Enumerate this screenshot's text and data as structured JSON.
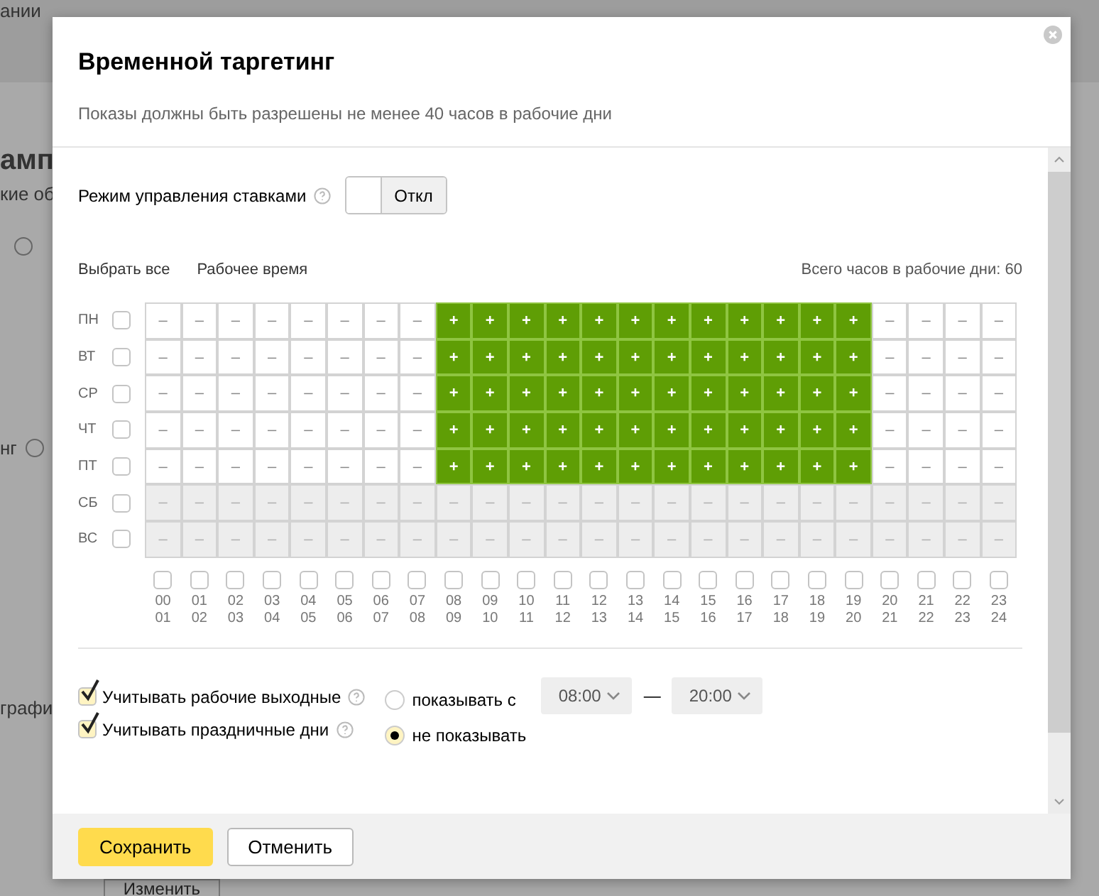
{
  "background": {
    "top_text": "ании",
    "heading": "амп",
    "subtext": "кие об",
    "row_label": "нг",
    "row_label_2": "графи",
    "button": "Изменить"
  },
  "dialog": {
    "title": "Временной таргетинг",
    "subtitle": "Показы должны быть разрешены не менее 40 часов в рабочие дни"
  },
  "bid_mode": {
    "label": "Режим управления ставками",
    "value": "Откл",
    "on": false
  },
  "links": [
    "Выбрать все",
    "Рабочее время"
  ],
  "total": "Всего часов в рабочие дни: 60",
  "days": [
    {
      "label": "ПН",
      "checked": false,
      "weekend": false,
      "cells": [
        "–",
        "–",
        "–",
        "–",
        "–",
        "–",
        "–",
        "–",
        "+",
        "+",
        "+",
        "+",
        "+",
        "+",
        "+",
        "+",
        "+",
        "+",
        "+",
        "+",
        "–",
        "–",
        "–",
        "–"
      ],
      "on": [
        false,
        false,
        false,
        false,
        false,
        false,
        false,
        false,
        true,
        true,
        true,
        true,
        true,
        true,
        true,
        true,
        true,
        true,
        true,
        true,
        false,
        false,
        false,
        false
      ]
    },
    {
      "label": "ВТ",
      "checked": false,
      "weekend": false,
      "cells": [
        "–",
        "–",
        "–",
        "–",
        "–",
        "–",
        "–",
        "–",
        "+",
        "+",
        "+",
        "+",
        "+",
        "+",
        "+",
        "+",
        "+",
        "+",
        "+",
        "+",
        "–",
        "–",
        "–",
        "–"
      ],
      "on": [
        false,
        false,
        false,
        false,
        false,
        false,
        false,
        false,
        true,
        true,
        true,
        true,
        true,
        true,
        true,
        true,
        true,
        true,
        true,
        true,
        false,
        false,
        false,
        false
      ]
    },
    {
      "label": "СР",
      "checked": false,
      "weekend": false,
      "cells": [
        "–",
        "–",
        "–",
        "–",
        "–",
        "–",
        "–",
        "–",
        "+",
        "+",
        "+",
        "+",
        "+",
        "+",
        "+",
        "+",
        "+",
        "+",
        "+",
        "+",
        "–",
        "–",
        "–",
        "–"
      ],
      "on": [
        false,
        false,
        false,
        false,
        false,
        false,
        false,
        false,
        true,
        true,
        true,
        true,
        true,
        true,
        true,
        true,
        true,
        true,
        true,
        true,
        false,
        false,
        false,
        false
      ]
    },
    {
      "label": "ЧТ",
      "checked": false,
      "weekend": false,
      "cells": [
        "–",
        "–",
        "–",
        "–",
        "–",
        "–",
        "–",
        "–",
        "+",
        "+",
        "+",
        "+",
        "+",
        "+",
        "+",
        "+",
        "+",
        "+",
        "+",
        "+",
        "–",
        "–",
        "–",
        "–"
      ],
      "on": [
        false,
        false,
        false,
        false,
        false,
        false,
        false,
        false,
        true,
        true,
        true,
        true,
        true,
        true,
        true,
        true,
        true,
        true,
        true,
        true,
        false,
        false,
        false,
        false
      ]
    },
    {
      "label": "ПТ",
      "checked": false,
      "weekend": false,
      "cells": [
        "–",
        "–",
        "–",
        "–",
        "–",
        "–",
        "–",
        "–",
        "+",
        "+",
        "+",
        "+",
        "+",
        "+",
        "+",
        "+",
        "+",
        "+",
        "+",
        "+",
        "–",
        "–",
        "–",
        "–"
      ],
      "on": [
        false,
        false,
        false,
        false,
        false,
        false,
        false,
        false,
        true,
        true,
        true,
        true,
        true,
        true,
        true,
        true,
        true,
        true,
        true,
        true,
        false,
        false,
        false,
        false
      ]
    },
    {
      "label": "СБ",
      "checked": false,
      "weekend": true,
      "cells": [
        "–",
        "–",
        "–",
        "–",
        "–",
        "–",
        "–",
        "–",
        "–",
        "–",
        "–",
        "–",
        "–",
        "–",
        "–",
        "–",
        "–",
        "–",
        "–",
        "–",
        "–",
        "–",
        "–",
        "–"
      ],
      "on": [
        false,
        false,
        false,
        false,
        false,
        false,
        false,
        false,
        false,
        false,
        false,
        false,
        false,
        false,
        false,
        false,
        false,
        false,
        false,
        false,
        false,
        false,
        false,
        false
      ]
    },
    {
      "label": "ВС",
      "checked": false,
      "weekend": true,
      "cells": [
        "–",
        "–",
        "–",
        "–",
        "–",
        "–",
        "–",
        "–",
        "–",
        "–",
        "–",
        "–",
        "–",
        "–",
        "–",
        "–",
        "–",
        "–",
        "–",
        "–",
        "–",
        "–",
        "–",
        "–"
      ],
      "on": [
        false,
        false,
        false,
        false,
        false,
        false,
        false,
        false,
        false,
        false,
        false,
        false,
        false,
        false,
        false,
        false,
        false,
        false,
        false,
        false,
        false,
        false,
        false,
        false
      ]
    }
  ],
  "hours": [
    {
      "from": "00",
      "to": "01",
      "checked": false
    },
    {
      "from": "01",
      "to": "02",
      "checked": false
    },
    {
      "from": "02",
      "to": "03",
      "checked": false
    },
    {
      "from": "03",
      "to": "04",
      "checked": false
    },
    {
      "from": "04",
      "to": "05",
      "checked": false
    },
    {
      "from": "05",
      "to": "06",
      "checked": false
    },
    {
      "from": "06",
      "to": "07",
      "checked": false
    },
    {
      "from": "07",
      "to": "08",
      "checked": false
    },
    {
      "from": "08",
      "to": "09",
      "checked": false
    },
    {
      "from": "09",
      "to": "10",
      "checked": false
    },
    {
      "from": "10",
      "to": "11",
      "checked": false
    },
    {
      "from": "11",
      "to": "12",
      "checked": false
    },
    {
      "from": "12",
      "to": "13",
      "checked": false
    },
    {
      "from": "13",
      "to": "14",
      "checked": false
    },
    {
      "from": "14",
      "to": "15",
      "checked": false
    },
    {
      "from": "15",
      "to": "16",
      "checked": false
    },
    {
      "from": "16",
      "to": "17",
      "checked": false
    },
    {
      "from": "17",
      "to": "18",
      "checked": false
    },
    {
      "from": "18",
      "to": "19",
      "checked": false
    },
    {
      "from": "19",
      "to": "20",
      "checked": false
    },
    {
      "from": "20",
      "to": "21",
      "checked": false
    },
    {
      "from": "21",
      "to": "22",
      "checked": false
    },
    {
      "from": "22",
      "to": "23",
      "checked": false
    },
    {
      "from": "23",
      "to": "24",
      "checked": false
    }
  ],
  "options": [
    {
      "label": "Учитывать рабочие выходные",
      "checked": true
    },
    {
      "label": "Учитывать праздничные дни",
      "checked": true
    }
  ],
  "holiday_modes": [
    {
      "label": "показывать с",
      "selected": false
    },
    {
      "label": "не показывать",
      "selected": true
    }
  ],
  "time_from": "08:00",
  "time_dash": "—",
  "time_to": "20:00",
  "buttons": [
    {
      "label": "Сохранить",
      "kind": "primary"
    },
    {
      "label": "Отменить",
      "kind": "secondary"
    }
  ]
}
